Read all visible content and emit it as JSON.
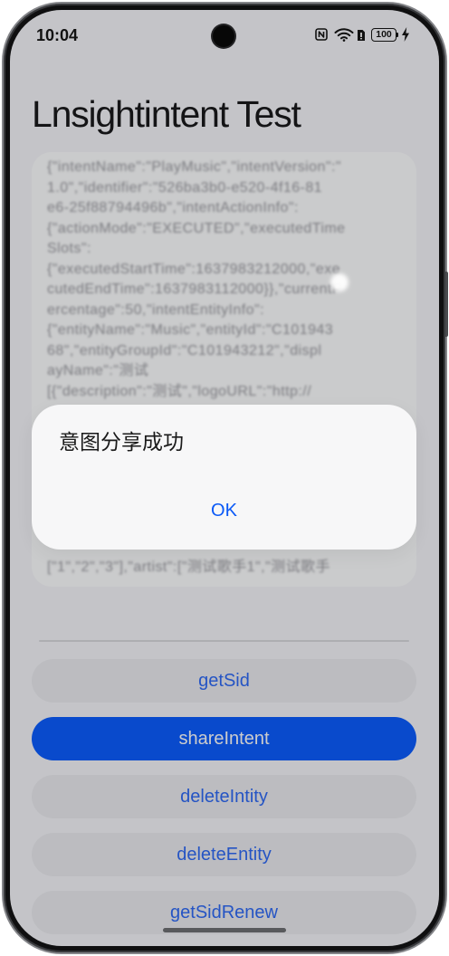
{
  "status_bar": {
    "time": "10:04",
    "battery_level": "100",
    "icons": [
      "nfc-icon",
      "wifi-icon",
      "sim-card-icon",
      "battery-icon",
      "charging-bolt-icon"
    ]
  },
  "app": {
    "title": "Lnsightintent Test"
  },
  "result_box": {
    "lines": [
      "{\"intentName\":\"PlayMusic\",\"intentVersion\":\"",
      "1.0\",\"identifier\":\"526ba3b0-e520-4f16-81",
      "e6-25f88794496b\",\"intentActionInfo\":",
      "{\"actionMode\":\"EXECUTED\",\"executedTime",
      "Slots\":",
      "{\"executedStartTime\":1637983212000,\"exe",
      "cutedEndTime\":1637983112000}},\"currentP",
      "ercentage\":50,\"intentEntityInfo\":",
      "{\"entityName\":\"Music\",\"entityId\":\"C101943",
      "68\",\"entityGroupId\":\"C101943212\",\"displ",
      "ayName\":\"测试",
      "[{\"description\":\"测试\",\"logoURL\":\"http://"
    ],
    "lines_below_dialog": [
      "[\"1\",\"2\",\"3\"],\"artist\":[\"测试歌手1\",\"测试歌手"
    ]
  },
  "dialog": {
    "message": "意图分享成功",
    "ok_label": "OK"
  },
  "buttons": [
    {
      "label": "getSid",
      "highlighted": false
    },
    {
      "label": "shareIntent",
      "highlighted": true
    },
    {
      "label": "deleteIntity",
      "highlighted": false
    },
    {
      "label": "deleteEntity",
      "highlighted": false
    },
    {
      "label": "getSidRenew",
      "highlighted": false
    }
  ],
  "colors": {
    "screen_background": "#f5f6fa",
    "result_box_background": "#fdfeff",
    "secondary_button": "#ebecf1",
    "primary_button": "#0c5dff",
    "button_text": "#2f6af5",
    "accent": "#0a59f7",
    "dialog_background": "#f7f7f8",
    "scrim": "rgba(0,0,0,0.2)"
  }
}
